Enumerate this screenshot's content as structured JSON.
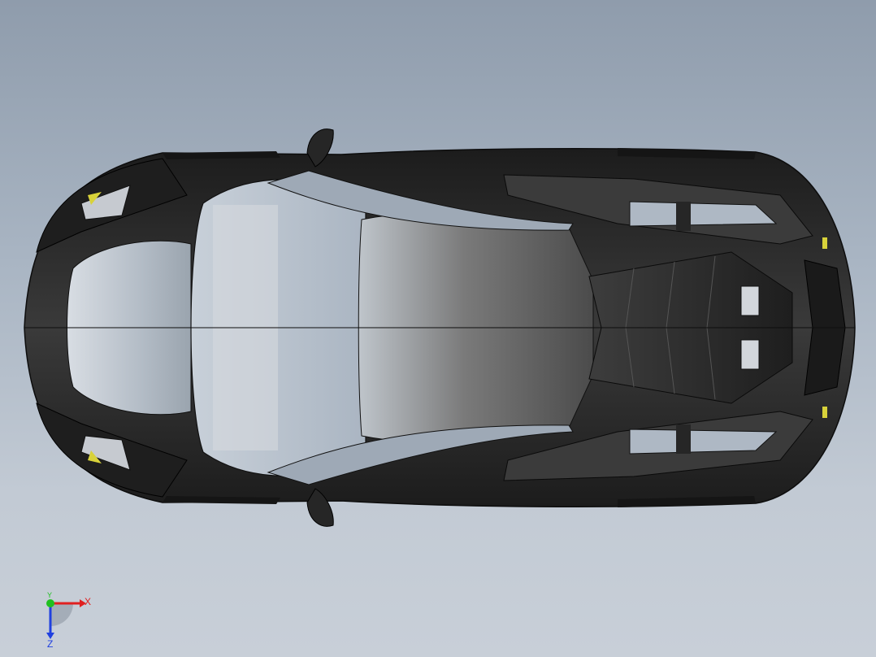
{
  "viewport": {
    "background_top": "#8f9cac",
    "background_bottom": "#c8cfd8"
  },
  "model": {
    "body_color": "#2b2b2b",
    "glass_color": "#b7c2cf",
    "edge_color": "#0d0d0d",
    "accent_color": "#d8d23a"
  },
  "triad": {
    "x_label": "X",
    "y_label": "Y",
    "z_label": "Z",
    "x_color": "#e02020",
    "y_color": "#20c020",
    "z_color": "#2040e0"
  }
}
